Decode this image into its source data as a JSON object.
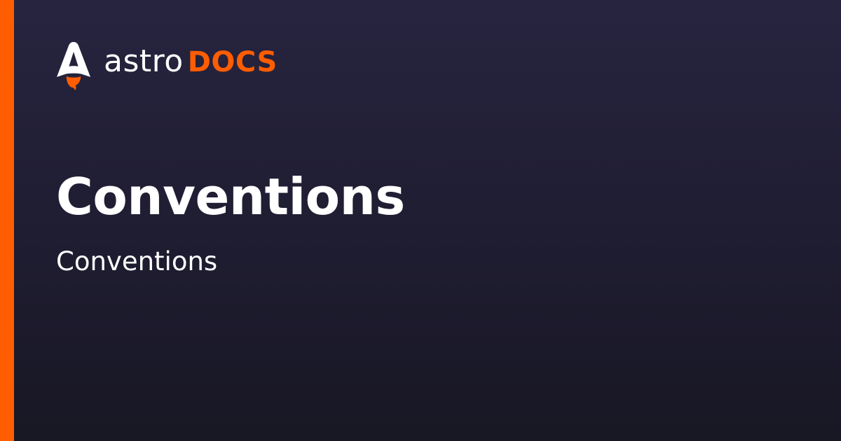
{
  "brand": {
    "name_primary": "astro",
    "name_secondary": "DOCS",
    "logo_icon": "astro-rocket-icon"
  },
  "page": {
    "title": "Conventions",
    "subtitle": "Conventions"
  },
  "colors": {
    "accent": "#FF5D01",
    "text": "#FFFFFF",
    "background_top": "#272440",
    "background_bottom": "#181724"
  }
}
